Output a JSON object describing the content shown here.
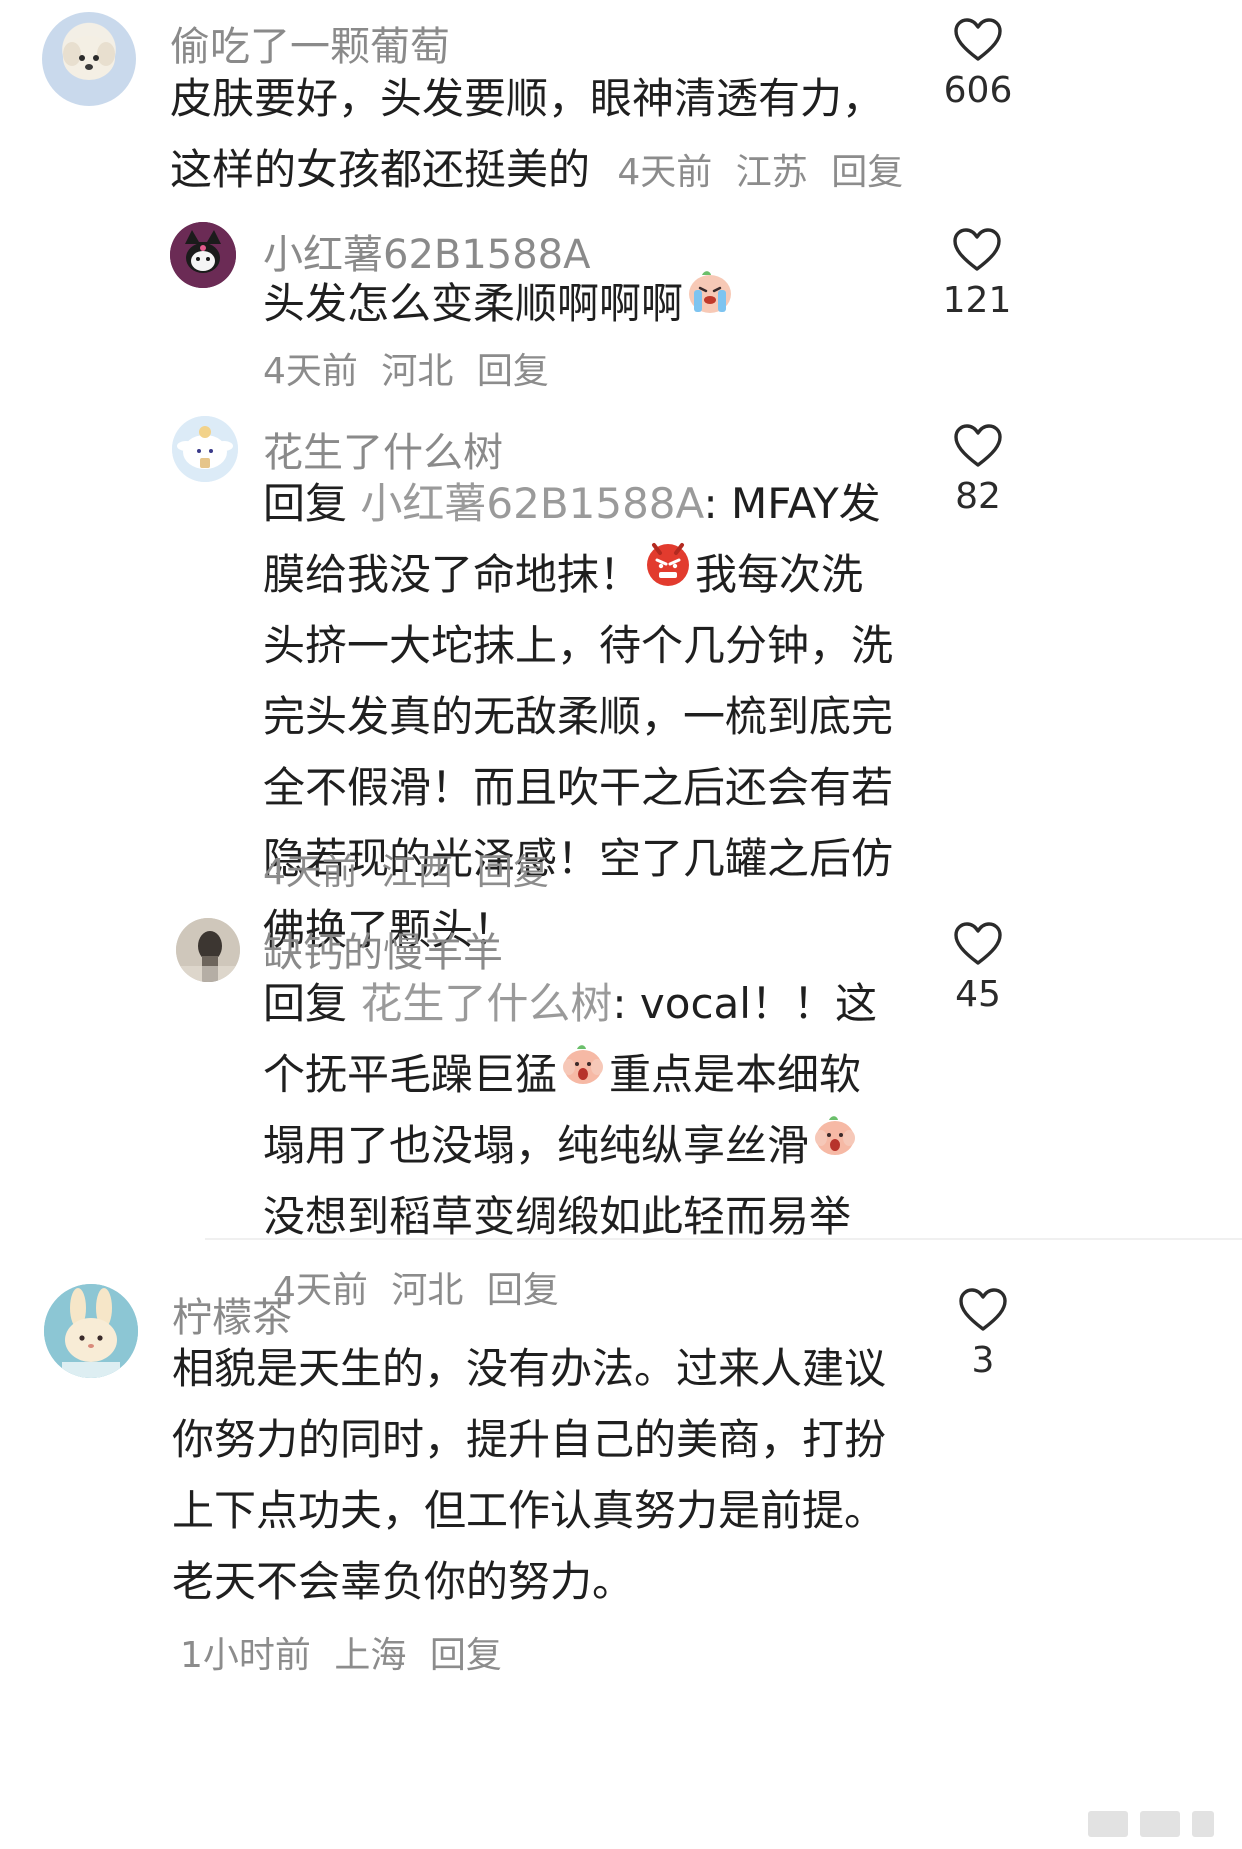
{
  "comments": [
    {
      "username": "偷吃了一颗葡萄",
      "text": "皮肤要好，头发要顺，眼神清透有力，这样的女孩都还挺美的",
      "time": "4天前",
      "location": "江苏",
      "reply": "回复",
      "likes": "606",
      "avatar": "puppy-avatar"
    },
    {
      "username": "小红薯62B1588A",
      "text": "头发怎么变柔顺啊啊啊",
      "emoji": "crying-face-emoji",
      "time": "4天前",
      "location": "河北",
      "reply": "回复",
      "likes": "121",
      "avatar": "kuromi-avatar"
    },
    {
      "username": "花生了什么树",
      "reply_prefix": "回复",
      "reply_target": "小红薯62B1588A",
      "text_part1": ": MFAY发膜给我没了命地抹！",
      "emoji": "angry-face-emoji",
      "text_part2": "我每次洗头挤一大坨抹上，待个几分钟，洗完头发真的无敌柔顺，一梳到底完全不假滑！而且吹干之后还会有若隐若现的光泽感！空了几罐之后仿佛换了颗头！",
      "time": "4天前",
      "location": "江西",
      "reply": "回复",
      "likes": "82",
      "avatar": "cinnamoroll-avatar"
    },
    {
      "username": "缺钙的慢羊羊",
      "reply_prefix": "回复",
      "reply_target": "花生了什么树",
      "text_part1": ": vocal！！这个抚平毛躁巨猛",
      "emoji1": "shocked-face-emoji",
      "text_part2": "重点是本细软塌用了也没塌，纯纯纵享丝滑",
      "emoji2": "shocked-face-emoji",
      "text_part3": "没想到稻草变绸缎如此轻而易举",
      "time": "4天前",
      "location": "河北",
      "reply": "回复",
      "likes": "45",
      "avatar": "photo-avatar"
    },
    {
      "username": "柠檬茶",
      "text": "相貌是天生的，没有办法。过来人建议你努力的同时，提升自己的美商，打扮上下点功夫，但工作认真努力是前提。老天不会辜负你的努力。",
      "time": "1小时前",
      "location": "上海",
      "reply": "回复",
      "likes": "3",
      "avatar": "bunny-avatar"
    }
  ],
  "colors": {
    "username": "#8a8a8a",
    "text": "#1f1f1f",
    "meta": "#8c8c8c",
    "reply_target": "#9a9a9a"
  },
  "icons": [
    "heart-outline-icon"
  ]
}
